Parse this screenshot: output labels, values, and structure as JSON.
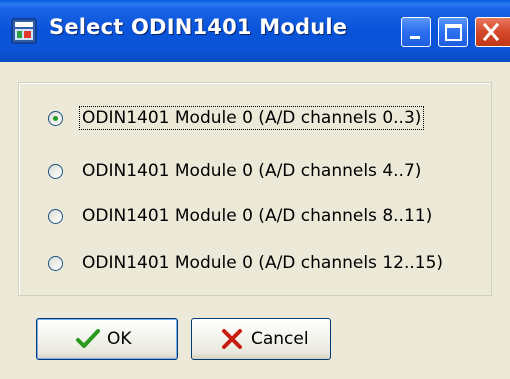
{
  "window": {
    "title": "Select ODIN1401 Module",
    "icons": {
      "app": "module-icon",
      "minimize": "minimize-icon",
      "maximize": "maximize-icon",
      "close": "close-icon"
    }
  },
  "options": [
    {
      "label": "ODIN1401 Module 0 (A/D channels 0..3)",
      "selected": true
    },
    {
      "label": "ODIN1401 Module 0 (A/D channels 4..7)",
      "selected": false
    },
    {
      "label": "ODIN1401 Module 0 (A/D channels 8..11)",
      "selected": false
    },
    {
      "label": "ODIN1401 Module 0 (A/D channels 12..15)",
      "selected": false
    }
  ],
  "buttons": {
    "ok_label": "OK",
    "ok_icon": "checkmark-icon",
    "cancel_label": "Cancel",
    "cancel_icon": "x-mark-icon"
  },
  "colors": {
    "titlebar": "#0a55d8",
    "dialog_bg": "#ece9d8",
    "radio_dot": "#1f9e1f",
    "ok_check": "#2a9a1e",
    "cancel_x": "#c81c10"
  }
}
